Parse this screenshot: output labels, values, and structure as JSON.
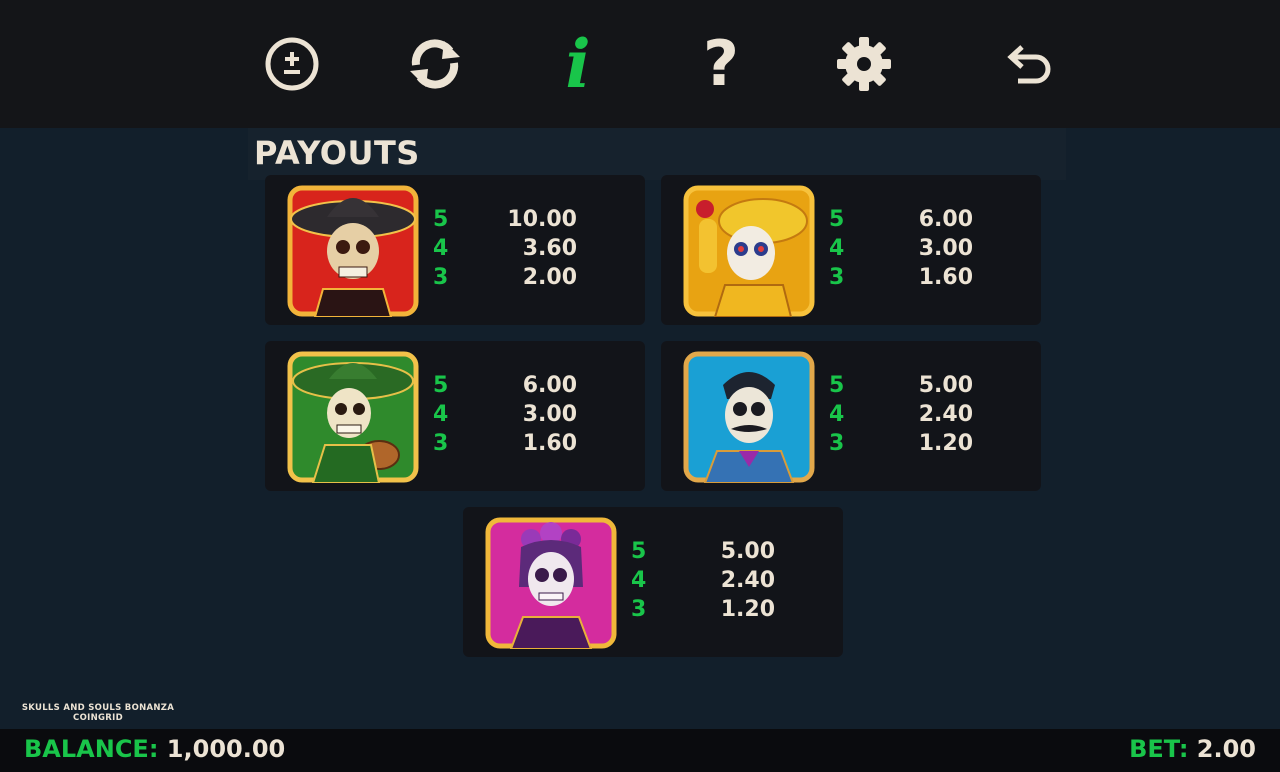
{
  "toolbar": {
    "bet_adjust": {
      "icon": "plus-minus-icon",
      "color": "#ece3d4"
    },
    "autoplay": {
      "icon": "refresh-icon",
      "color": "#ece3d4"
    },
    "info": {
      "glyph": "i",
      "icon": "info-icon",
      "color": "#19c54a"
    },
    "help": {
      "glyph": "?",
      "icon": "question-icon",
      "color": "#ece3d4"
    },
    "settings": {
      "icon": "gear-icon",
      "color": "#ece3d4"
    },
    "back": {
      "icon": "back-arrow-icon",
      "color": "#ece3d4"
    }
  },
  "page_title": "PAYOUTS",
  "payouts": [
    {
      "symbol": "red-sombrero-skeleton-symbol",
      "rows": [
        {
          "count": "5",
          "payout": "10.00"
        },
        {
          "count": "4",
          "payout": "3.60"
        },
        {
          "count": "3",
          "payout": "2.00"
        }
      ]
    },
    {
      "symbol": "yellow-sugar-skull-dancer-symbol",
      "rows": [
        {
          "count": "5",
          "payout": "6.00"
        },
        {
          "count": "4",
          "payout": "3.00"
        },
        {
          "count": "3",
          "payout": "1.60"
        }
      ]
    },
    {
      "symbol": "green-guitar-skeleton-symbol",
      "rows": [
        {
          "count": "5",
          "payout": "6.00"
        },
        {
          "count": "4",
          "payout": "3.00"
        },
        {
          "count": "3",
          "payout": "1.60"
        }
      ]
    },
    {
      "symbol": "blue-mustache-skeleton-symbol",
      "rows": [
        {
          "count": "5",
          "payout": "5.00"
        },
        {
          "count": "4",
          "payout": "2.40"
        },
        {
          "count": "3",
          "payout": "1.20"
        }
      ]
    },
    {
      "symbol": "pink-catrina-skeleton-symbol",
      "rows": [
        {
          "count": "5",
          "payout": "5.00"
        },
        {
          "count": "4",
          "payout": "2.40"
        },
        {
          "count": "3",
          "payout": "1.20"
        }
      ]
    }
  ],
  "game_logo": {
    "line1": "SKULLS AND SOULS BONANZA",
    "line2": "COINGRID"
  },
  "footer": {
    "balance_label": "BALANCE:",
    "balance_value": "1,000.00",
    "bet_label": "BET:",
    "bet_value": "2.00"
  },
  "colors": {
    "accent": "#19c54a",
    "text": "#ece3d4",
    "background": "#121f2b",
    "card": "#121419",
    "topbar": "#141518"
  }
}
